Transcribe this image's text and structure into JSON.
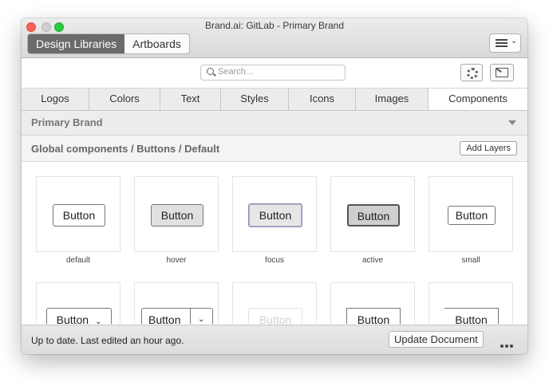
{
  "window": {
    "title": "Brand.ai: GitLab - Primary Brand"
  },
  "header": {
    "segments": [
      "Design Libraries",
      "Artboards"
    ],
    "active_segment": "Design Libraries",
    "menu_icon": "hamburger-menu-icon"
  },
  "toolbar": {
    "search_placeholder": "Search...",
    "settings_icon": "gear-icon",
    "export_icon": "export-icon"
  },
  "tabs": [
    {
      "label": "Logos"
    },
    {
      "label": "Colors"
    },
    {
      "label": "Text"
    },
    {
      "label": "Styles"
    },
    {
      "label": "Icons"
    },
    {
      "label": "Images"
    },
    {
      "label": "Components",
      "active": true
    }
  ],
  "section": {
    "title": "Primary Brand"
  },
  "breadcrumb": {
    "path": "Global components / Buttons / Default",
    "add_layers": "Add Layers"
  },
  "components": [
    {
      "text": "Button",
      "label": "default"
    },
    {
      "text": "Button",
      "label": "hover"
    },
    {
      "text": "Button",
      "label": "focus"
    },
    {
      "text": "Button",
      "label": "active"
    },
    {
      "text": "Button",
      "label": "small"
    },
    {
      "text": "Button"
    },
    {
      "text": "Button"
    },
    {
      "text": "Button"
    },
    {
      "text": "Button"
    },
    {
      "text": "Button"
    }
  ],
  "footer": {
    "status": "Up to date. Last edited an hour ago.",
    "update_button": "Update Document",
    "more_icon": "more-icon"
  }
}
